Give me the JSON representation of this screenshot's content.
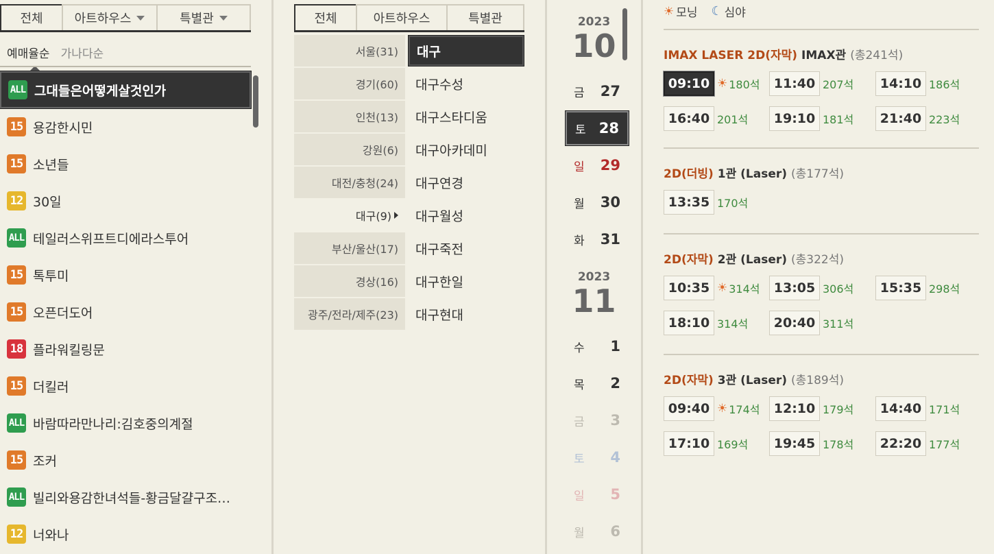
{
  "movie_tabs": [
    {
      "label": "전체",
      "dropdown": false,
      "active": true
    },
    {
      "label": "아트하우스",
      "dropdown": true,
      "active": false
    },
    {
      "label": "특별관",
      "dropdown": true,
      "active": false
    }
  ],
  "sort_options": [
    {
      "label": "예매율순",
      "active": true
    },
    {
      "label": "가나다순",
      "active": false
    }
  ],
  "movies": [
    {
      "rating": "ALL",
      "color": "#2f9d4f",
      "title": "그대들은어떻게살것인가",
      "selected": true
    },
    {
      "rating": "15",
      "color": "#e07a2a",
      "title": "용감한시민"
    },
    {
      "rating": "15",
      "color": "#e07a2a",
      "title": "소년들"
    },
    {
      "rating": "12",
      "color": "#e6b72d",
      "title": "30일"
    },
    {
      "rating": "ALL",
      "color": "#2f9d4f",
      "title": "테일러스위프트디에라스투어"
    },
    {
      "rating": "15",
      "color": "#e07a2a",
      "title": "톡투미"
    },
    {
      "rating": "15",
      "color": "#e07a2a",
      "title": "오픈더도어"
    },
    {
      "rating": "18",
      "color": "#d8333d",
      "title": "플라워킬링문"
    },
    {
      "rating": "15",
      "color": "#e07a2a",
      "title": "더킬러"
    },
    {
      "rating": "ALL",
      "color": "#2f9d4f",
      "title": "바람따라만나리:김호중의계절"
    },
    {
      "rating": "15",
      "color": "#e07a2a",
      "title": "조커"
    },
    {
      "rating": "ALL",
      "color": "#2f9d4f",
      "title": "빌리와용감한녀석들-황금달걀구조…"
    },
    {
      "rating": "12",
      "color": "#e6b72d",
      "title": "너와나"
    }
  ],
  "theater_tabs": [
    {
      "label": "전체",
      "active": true
    },
    {
      "label": "아트하우스",
      "active": false
    },
    {
      "label": "특별관",
      "active": false
    }
  ],
  "regions": [
    {
      "label": "서울(31)"
    },
    {
      "label": "경기(60)"
    },
    {
      "label": "인천(13)"
    },
    {
      "label": "강원(6)"
    },
    {
      "label": "대전/충청(24)"
    },
    {
      "label": "대구(9)",
      "active": true
    },
    {
      "label": "부산/울산(17)"
    },
    {
      "label": "경상(16)"
    },
    {
      "label": "광주/전라/제주(23)"
    }
  ],
  "theaters": [
    {
      "label": "대구",
      "selected": true
    },
    {
      "label": "대구수성"
    },
    {
      "label": "대구스타디움"
    },
    {
      "label": "대구아카데미"
    },
    {
      "label": "대구연경"
    },
    {
      "label": "대구월성"
    },
    {
      "label": "대구죽전"
    },
    {
      "label": "대구한일"
    },
    {
      "label": "대구현대"
    }
  ],
  "calendar": {
    "oct_year": "2023",
    "oct_month": "10",
    "nov_year": "2023",
    "nov_month": "11",
    "oct_days": [
      {
        "dow": "금",
        "num": "27",
        "color": "#333"
      },
      {
        "dow": "토",
        "num": "28",
        "color": "#fff",
        "selected": true
      },
      {
        "dow": "일",
        "num": "29",
        "color": "#b22a2a"
      },
      {
        "dow": "월",
        "num": "30",
        "color": "#333"
      },
      {
        "dow": "화",
        "num": "31",
        "color": "#333"
      }
    ],
    "nov_days": [
      {
        "dow": "수",
        "num": "1",
        "color": "#333"
      },
      {
        "dow": "목",
        "num": "2",
        "color": "#333"
      },
      {
        "dow": "금",
        "num": "3",
        "color": "#bdbab0"
      },
      {
        "dow": "토",
        "num": "4",
        "color": "#b3c2d6"
      },
      {
        "dow": "일",
        "num": "5",
        "color": "#e2b4b4"
      },
      {
        "dow": "월",
        "num": "6",
        "color": "#bdbab0"
      }
    ]
  },
  "legend": {
    "morning": "모닝",
    "night": "심야"
  },
  "halls": [
    {
      "format": "IMAX LASER 2D(자막)",
      "name": "IMAX관",
      "total": "(총241석)",
      "times": [
        {
          "time": "09:10",
          "seats": "180석",
          "morning": true,
          "selected": true
        },
        {
          "time": "11:40",
          "seats": "207석"
        },
        {
          "time": "14:10",
          "seats": "186석"
        },
        {
          "time": "16:40",
          "seats": "201석"
        },
        {
          "time": "19:10",
          "seats": "181석"
        },
        {
          "time": "21:40",
          "seats": "223석"
        }
      ]
    },
    {
      "format": "2D(더빙)",
      "name": "1관 (Laser)",
      "total": "(총177석)",
      "times": [
        {
          "time": "13:35",
          "seats": "170석"
        }
      ]
    },
    {
      "format": "2D(자막)",
      "name": "2관 (Laser)",
      "total": "(총322석)",
      "times": [
        {
          "time": "10:35",
          "seats": "314석",
          "morning": true
        },
        {
          "time": "13:05",
          "seats": "306석"
        },
        {
          "time": "15:35",
          "seats": "298석"
        },
        {
          "time": "18:10",
          "seats": "314석"
        },
        {
          "time": "20:40",
          "seats": "311석"
        }
      ]
    },
    {
      "format": "2D(자막)",
      "name": "3관 (Laser)",
      "total": "(총189석)",
      "times": [
        {
          "time": "09:40",
          "seats": "174석",
          "morning": true
        },
        {
          "time": "12:10",
          "seats": "179석"
        },
        {
          "time": "14:40",
          "seats": "171석"
        },
        {
          "time": "17:10",
          "seats": "169석"
        },
        {
          "time": "19:45",
          "seats": "178석"
        },
        {
          "time": "22:20",
          "seats": "177석"
        }
      ]
    }
  ]
}
